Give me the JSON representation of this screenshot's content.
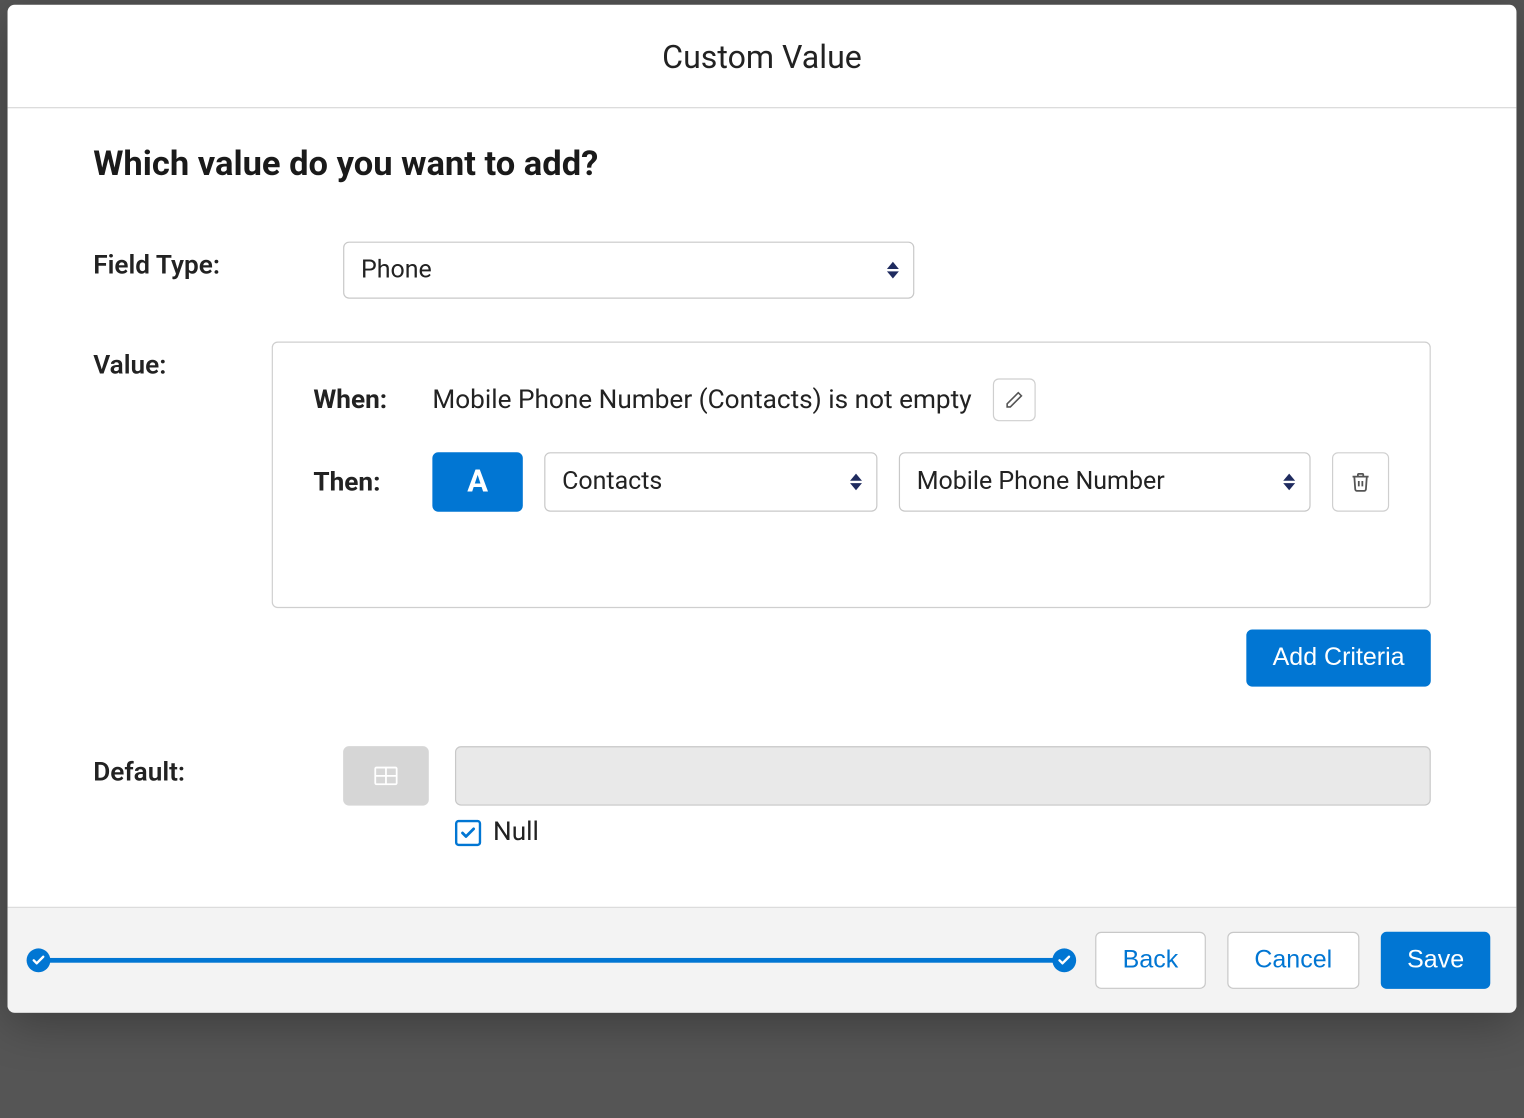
{
  "modal": {
    "title": "Custom Value",
    "question": "Which value do you want to add?",
    "fieldType": {
      "label": "Field Type:",
      "value": "Phone"
    },
    "value": {
      "label": "Value:",
      "whenLabel": "When:",
      "whenText": "Mobile Phone Number (Contacts) is not empty",
      "thenLabel": "Then:",
      "badge": "A",
      "thenSelect1": "Contacts",
      "thenSelect2": "Mobile Phone Number",
      "addCriteria": "Add Criteria"
    },
    "default": {
      "label": "Default:",
      "inputValue": "",
      "nullChecked": true,
      "nullLabel": "Null"
    },
    "footer": {
      "back": "Back",
      "cancel": "Cancel",
      "save": "Save"
    }
  }
}
